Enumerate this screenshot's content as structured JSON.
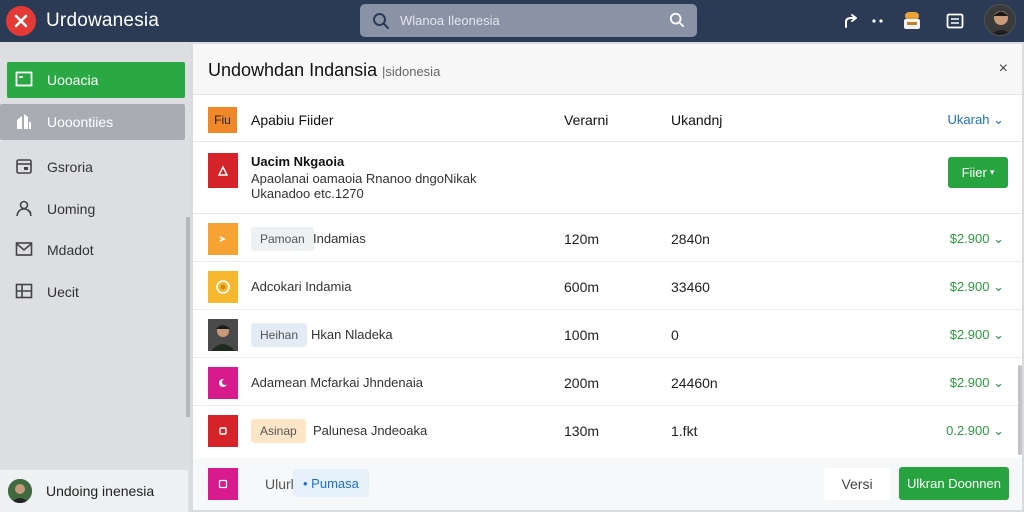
{
  "app": {
    "name": "Urdowanesia",
    "colors": {
      "topbar": "#2b3a55",
      "accent": "#2aa844",
      "link": "#1e6fd0",
      "logo": "#e53935"
    }
  },
  "search": {
    "placeholder": "Wlanoa Ileonesia",
    "left_icon": "search-icon",
    "right_icon": "search-icon"
  },
  "topbar_icons": [
    "share-icon",
    "more-icon",
    "notification-icon",
    "message-icon",
    "user-avatar"
  ],
  "sidebar": {
    "items": [
      {
        "label": "Uooacia",
        "icon": "inbox-icon",
        "state": "active"
      },
      {
        "label": "Uooontiies",
        "icon": "chart-icon",
        "state": "selected"
      },
      {
        "label": "Gsroria",
        "icon": "calendar-icon",
        "state": ""
      },
      {
        "label": "Uoming",
        "icon": "user-icon",
        "state": ""
      },
      {
        "label": "Mdadot",
        "icon": "mail-icon",
        "state": ""
      },
      {
        "label": "Uecit",
        "icon": "grid-icon",
        "state": ""
      }
    ],
    "user": {
      "name": "Undoing inenesia"
    }
  },
  "panel": {
    "title": "Undowhdan Indansia",
    "subtitle": "|sidonesia",
    "close": "×",
    "header": {
      "badge": "Fiu",
      "col1": "Apabiu Fiider",
      "col2": "Verarni",
      "col3": "Ukandnj",
      "right": "Ukarah"
    },
    "highlight": {
      "title": "Uacim Nkgaoia",
      "line1": "Apaolanai oamaoia Rnanoo dngoNikak",
      "line2": "Ukanadoo etc.1270",
      "button": "Fiier"
    },
    "rows": [
      {
        "tag": "Pamoan",
        "name": "Indamias",
        "c2": "120m",
        "c3": "2840n",
        "price": "$2.900",
        "icon_color": "#f7a333",
        "tag_bg": "#eef1f4"
      },
      {
        "tag": "",
        "name": "Adcokari Indamia",
        "c2": "600m",
        "c3": "33460",
        "price": "$2.900",
        "icon_color": "#f5b82e",
        "tag_bg": ""
      },
      {
        "tag": "Heihan",
        "name": "Hkan Nladeka",
        "c2": "100m",
        "c3": "0",
        "price": "$2.900",
        "icon_color": "#333333",
        "tag_bg": "#e3ecf6"
      },
      {
        "tag": "",
        "name": "Adamean Mcfarkai Jhndenaia",
        "c2": "200m",
        "c3": "24460n",
        "price": "$2.900",
        "icon_color": "#d81b8c",
        "tag_bg": ""
      },
      {
        "tag": "Asinap",
        "name": "Palunesa Jndeoaka",
        "c2": "130m",
        "c3": "1.fkt",
        "price": "0.2.900",
        "icon_color": "#d6232a",
        "tag_bg": "#fde6c8"
      }
    ],
    "footer": {
      "label": "Ulurle",
      "tag": "• Pumasa",
      "secondary": "Versi",
      "primary": "Ulkran Doonnen"
    }
  }
}
